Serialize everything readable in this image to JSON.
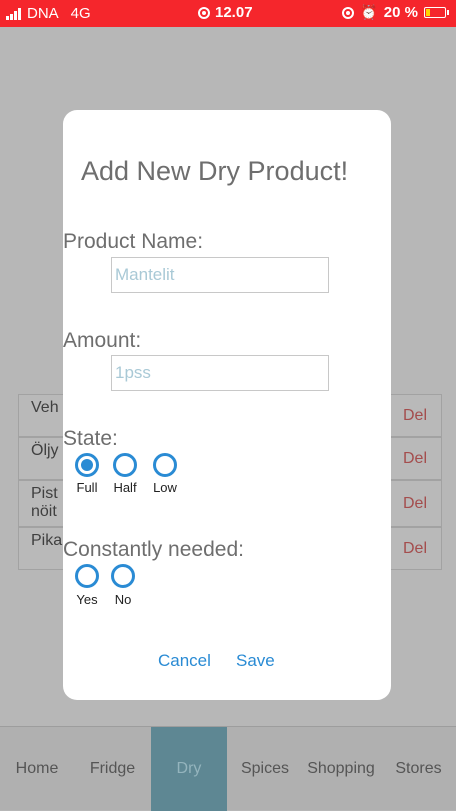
{
  "status_bar": {
    "carrier": "DNA",
    "network": "4G",
    "time": "12.07",
    "battery": "20 %",
    "background_color": "#f5262c"
  },
  "background_list": {
    "rows": [
      {
        "name": "Veh",
        "action": "Del"
      },
      {
        "name": "Öljy",
        "action": "Del"
      },
      {
        "name": "Pist\nnöit",
        "action": "Del"
      },
      {
        "name": "Pika",
        "action": "Del"
      }
    ]
  },
  "dialog": {
    "title": "Add New Dry Product!",
    "product_name_label": "Product Name:",
    "product_name_placeholder": "Mantelit",
    "amount_label": "Amount:",
    "amount_placeholder": "1pss",
    "state_label": "State:",
    "state_options": [
      {
        "label": "Full",
        "selected": true
      },
      {
        "label": "Half",
        "selected": false
      },
      {
        "label": "Low",
        "selected": false
      }
    ],
    "needed_label": "Constantly needed:",
    "needed_options": [
      {
        "label": "Yes",
        "selected": false
      },
      {
        "label": "No",
        "selected": false
      }
    ],
    "cancel_label": "Cancel",
    "save_label": "Save",
    "accent_color": "#2a8bd4"
  },
  "tab_bar": {
    "tabs": [
      {
        "label": "Home",
        "active": false
      },
      {
        "label": "Fridge",
        "active": false
      },
      {
        "label": "Dry",
        "active": true
      },
      {
        "label": "Spices",
        "active": false
      },
      {
        "label": "Shopping",
        "active": false
      },
      {
        "label": "Stores",
        "active": false
      }
    ]
  }
}
